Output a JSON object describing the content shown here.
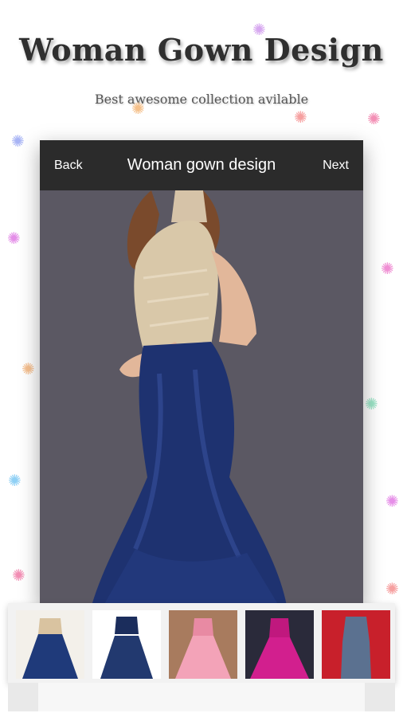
{
  "promo": {
    "title": "Woman Gown Design",
    "subtitle": "Best awesome collection avilable"
  },
  "toolbar": {
    "back_label": "Back",
    "title": "Woman gown design",
    "next_label": "Next"
  },
  "colors": {
    "toolbar_bg": "#2b2b2b",
    "photo_bg": "#5b5863",
    "gown_blue": "#1e3270"
  },
  "thumbnails": [
    {
      "name": "navy embellished gown"
    },
    {
      "name": "navy two-piece gown"
    },
    {
      "name": "pink lehenga gown"
    },
    {
      "name": "magenta ball gown"
    },
    {
      "name": "denim shirt dress"
    }
  ]
}
